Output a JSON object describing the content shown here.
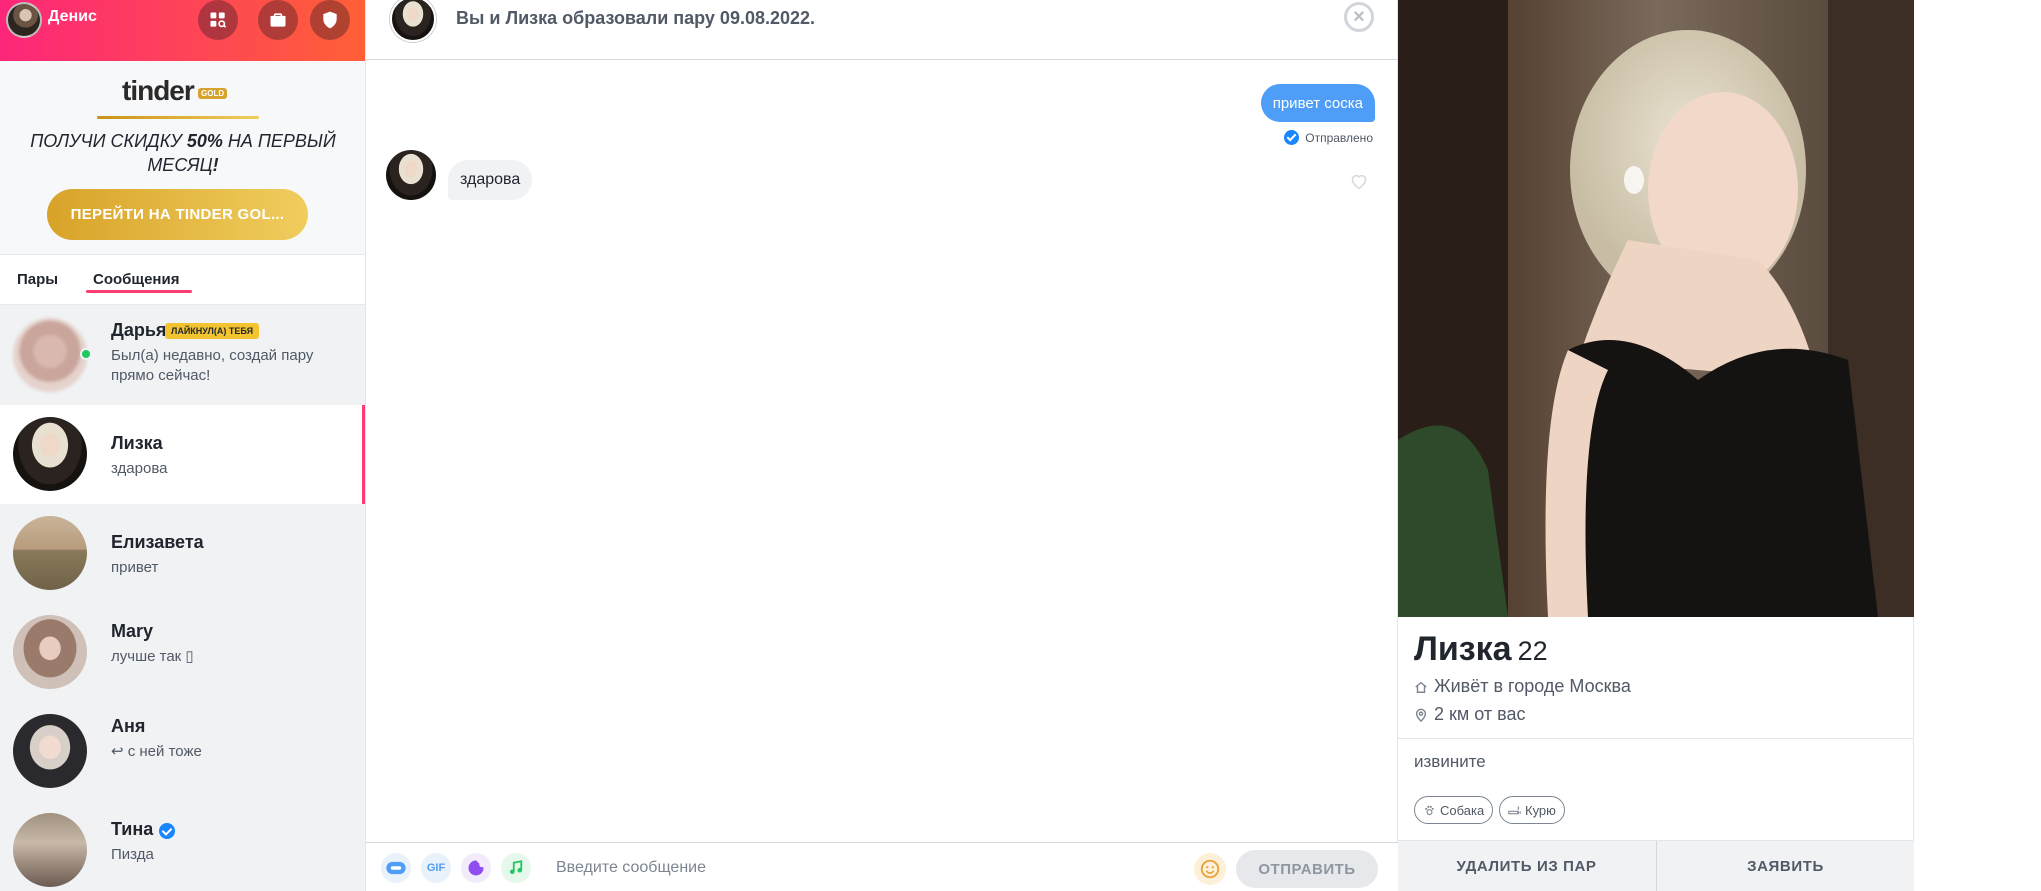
{
  "user": {
    "name": "Денис"
  },
  "promo": {
    "logo": "tinder",
    "logo_badge": "GOLD",
    "offer_part1": "ПОЛУЧИ СКИДКУ ",
    "offer_bold": "50%",
    "offer_part2": " НА ПЕРВЫЙ МЕСЯЦ",
    "offer_excl": "!",
    "button": "ПЕРЕЙТИ НА TINDER GOL..."
  },
  "tabs": {
    "matches": "Пары",
    "messages": "Сообщения",
    "active": "messages"
  },
  "conversations": [
    {
      "name": "Дарья",
      "badge": "ЛАЙКНУЛ(А) ТЕБЯ",
      "preview": "Был(а) недавно, создай пару прямо сейчас!",
      "online": true
    },
    {
      "name": "Лизка",
      "preview": "здарова",
      "active": true
    },
    {
      "name": "Елизавета",
      "preview": "привет"
    },
    {
      "name": "Mary",
      "preview": "лучше так ▯"
    },
    {
      "name": "Аня",
      "preview": "↩ с ней тоже"
    },
    {
      "name": "Тина",
      "preview": "Пизда",
      "verified": true
    }
  ],
  "chat": {
    "header": "Вы и Лизка образовали пару 09.08.2022.",
    "close": "×",
    "outgoing": "привет соска",
    "status": "Отправлено",
    "incoming": "здарова"
  },
  "composer": {
    "placeholder": "Введите сообщение",
    "gif": "GIF",
    "send": "ОТПРАВИТЬ"
  },
  "profile": {
    "name": "Лизка",
    "age": "22",
    "city": "Живёт в городе Москва",
    "distance": "2 км от вас",
    "bio": "извините",
    "chips": [
      "Собака",
      "Курю"
    ],
    "unmatch": "УДАЛИТЬ ИЗ ПАР",
    "report": "ЗАЯВИТЬ"
  },
  "colors": {
    "accent": "#fe3c72",
    "blue": "#4e9df7",
    "gold": "#d8a329"
  }
}
